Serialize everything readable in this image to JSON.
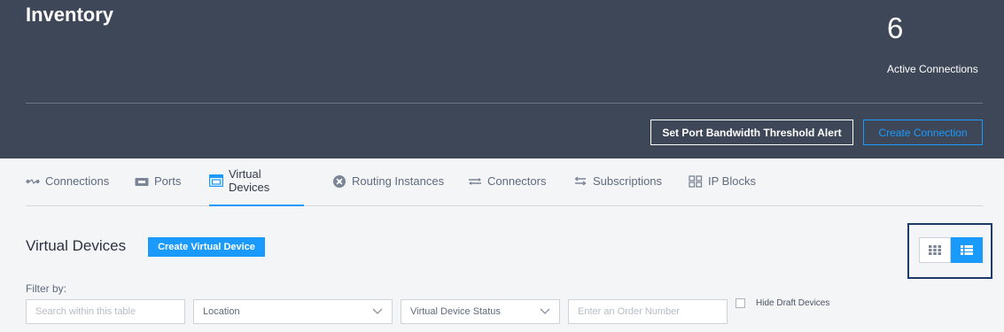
{
  "header": {
    "title": "Inventory",
    "active_connections_count": "6",
    "active_connections_label": "Active Connections",
    "set_alert_button": "Set Port Bandwidth Threshold Alert",
    "create_connection_button": "Create Connection"
  },
  "tabs": [
    {
      "label": "Connections",
      "icon": "connections-icon"
    },
    {
      "label": "Ports",
      "icon": "ports-icon"
    },
    {
      "label": "Virtual Devices",
      "icon": "virtual-devices-icon",
      "active": true
    },
    {
      "label": "Routing Instances",
      "icon": "routing-icon"
    },
    {
      "label": "Connectors",
      "icon": "connectors-icon"
    },
    {
      "label": "Subscriptions",
      "icon": "subscriptions-icon"
    },
    {
      "label": "IP Blocks",
      "icon": "ip-blocks-icon"
    }
  ],
  "section": {
    "title": "Virtual Devices",
    "create_button": "Create Virtual Device"
  },
  "view_toggle": {
    "grid_icon": "grid-view-icon",
    "list_icon": "list-view-icon",
    "selected": "list"
  },
  "filters": {
    "label": "Filter by:",
    "search_placeholder": "Search within this table",
    "location": "Location",
    "status": "Virtual Device Status",
    "order_placeholder": "Enter an Order Number",
    "hide_draft_label": "Hide Draft Devices"
  },
  "colors": {
    "header_bg": "#3e4758",
    "accent": "#1a9bfc",
    "page_bg": "#f4f5f7"
  }
}
